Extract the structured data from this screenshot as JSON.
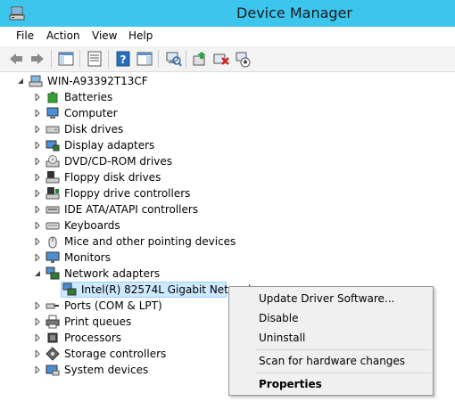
{
  "window": {
    "title": "Device Manager"
  },
  "menu": [
    "File",
    "Action",
    "View",
    "Help"
  ],
  "toolbar": {
    "buttons": [
      "back-icon",
      "forward-icon",
      "show-hide-console-tree-icon",
      "properties-icon",
      "help-icon",
      "show-action-pane-icon",
      "scan-hardware-icon",
      "update-driver-icon",
      "uninstall-icon",
      "enable-device-icon"
    ]
  },
  "tree": {
    "root": "WIN-A93392T13CF",
    "categories": [
      "Batteries",
      "Computer",
      "Disk drives",
      "Display adapters",
      "DVD/CD-ROM drives",
      "Floppy disk drives",
      "Floppy drive controllers",
      "IDE ATA/ATAPI controllers",
      "Keyboards",
      "Mice and other pointing devices",
      "Monitors",
      "Network adapters",
      "Ports (COM & LPT)",
      "Print queues",
      "Processors",
      "Storage controllers",
      "System devices"
    ],
    "expanded_category": "Network adapters",
    "selected_device": "Intel(R) 82574L Gigabit Network"
  },
  "context_menu": {
    "items": [
      "Update Driver Software...",
      "Disable",
      "Uninstall",
      "Scan for hardware changes",
      "Properties"
    ]
  },
  "colors": {
    "titlebar": "#3cc6ee",
    "selection": "#cde8ff",
    "selection_border": "#99d1ff"
  }
}
